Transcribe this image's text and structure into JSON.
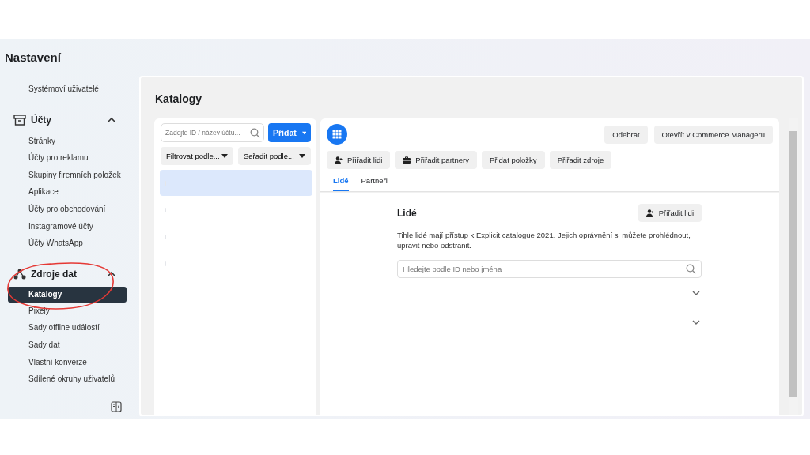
{
  "header": {
    "title": "Nastavení"
  },
  "sidebar": {
    "sections": [
      {
        "items": [
          {
            "label": "Systémoví uživatelé",
            "selected": false
          }
        ]
      },
      {
        "title": "Účty",
        "expanded": true,
        "items": [
          {
            "label": "Stránky",
            "selected": false
          },
          {
            "label": "Účty pro reklamu",
            "selected": false
          },
          {
            "label": "Skupiny firemních položek",
            "selected": false
          },
          {
            "label": "Aplikace",
            "selected": false
          },
          {
            "label": "Účty pro obchodování",
            "selected": false
          },
          {
            "label": "Instagramové účty",
            "selected": false
          },
          {
            "label": "Účty WhatsApp",
            "selected": false
          }
        ]
      },
      {
        "title": "Zdroje dat",
        "expanded": true,
        "items": [
          {
            "label": "Katalogy",
            "selected": true
          },
          {
            "label": "Pixely",
            "selected": false
          },
          {
            "label": "Sady offline událostí",
            "selected": false
          },
          {
            "label": "Sady dat",
            "selected": false
          },
          {
            "label": "Vlastní konverze",
            "selected": false
          },
          {
            "label": "Sdílené okruhy uživatelů",
            "selected": false
          }
        ]
      }
    ]
  },
  "page": {
    "title": "Katalogy"
  },
  "catalog_list": {
    "search": {
      "placeholder": "Zadejte ID / název účtu..."
    },
    "add_button": "Přidat",
    "filter": "Filtrovat podle...",
    "sort": "Seřadit podle...",
    "rows": [
      {
        "selected": true
      },
      {
        "selected": false
      },
      {
        "selected": false
      },
      {
        "selected": false
      }
    ]
  },
  "detail": {
    "actions": [
      "Odebrat",
      "Otevřít v Commerce Manageru"
    ],
    "buttons": [
      "Přiřadit lidi",
      "Přiřadit partnery",
      "Přidat položky",
      "Přiřadit zdroje"
    ],
    "tabs": [
      {
        "label": "Lidé",
        "selected": true
      },
      {
        "label": "Partneři",
        "selected": false
      }
    ],
    "people": {
      "title": "Lidé",
      "assign_button": "Přiřadit lidi",
      "description": "Tihle lidé mají přístup k Explicit catalogue 2021. Jejich oprávnění si můžete prohlédnout, upravit nebo odstranit.",
      "search": {
        "placeholder": "Hledejte podle ID nebo jména"
      },
      "rows": [
        {
          "expanded": false
        },
        {
          "expanded": false
        }
      ]
    }
  },
  "annotation": {
    "kind": "circle",
    "color": "#e53935"
  }
}
